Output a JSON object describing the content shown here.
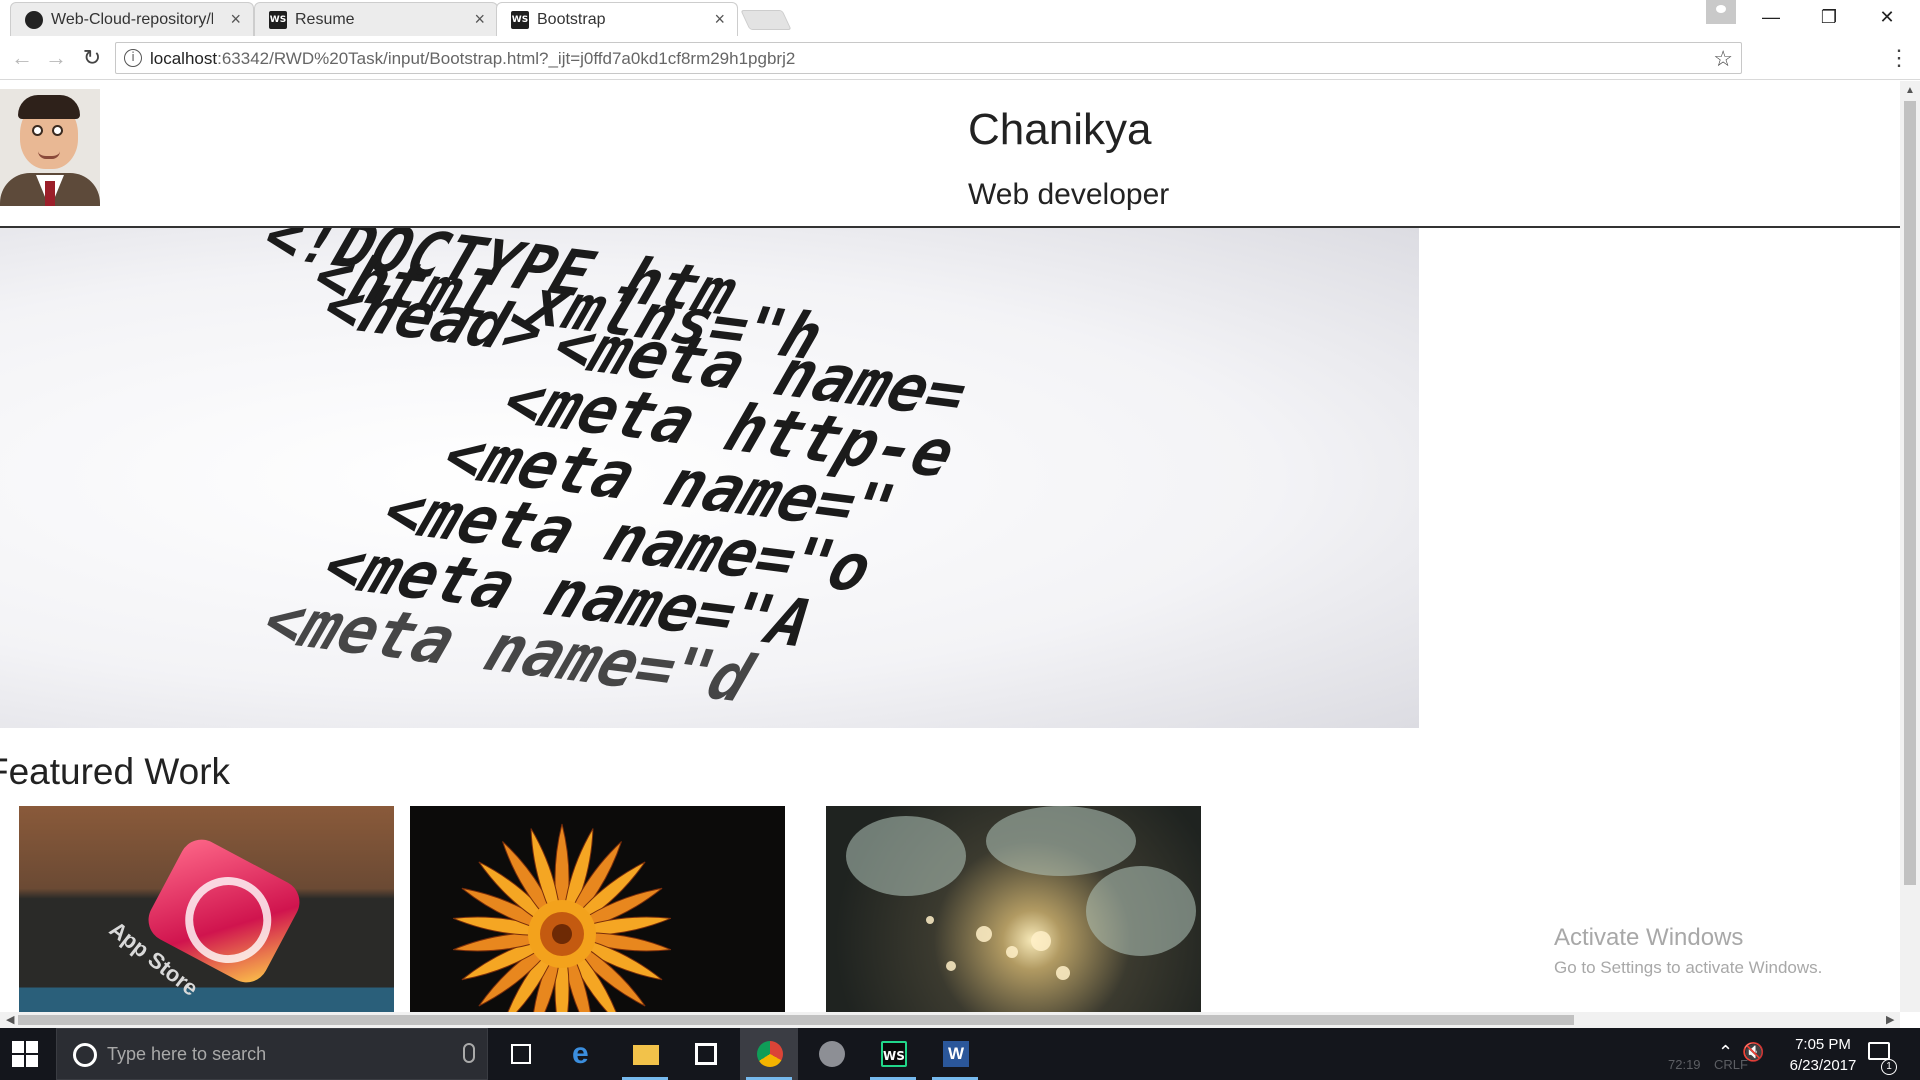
{
  "browser": {
    "tabs": [
      {
        "title": "Web-Cloud-repository/lab",
        "icon": "github-icon",
        "close": "×",
        "active": false
      },
      {
        "title": "Resume",
        "icon": "webstorm-icon",
        "close": "×",
        "active": false
      },
      {
        "title": "Bootstrap",
        "icon": "webstorm-icon",
        "close": "×",
        "active": true
      }
    ],
    "icon_label_ws": "WS",
    "window_controls": {
      "minimize": "—",
      "restore": "❐",
      "close": "✕"
    },
    "nav": {
      "back": "←",
      "forward": "→",
      "reload": "↻",
      "info": "i",
      "star": "☆",
      "menu": "⋮"
    },
    "url_host": "localhost",
    "url_rest": ":63342/RWD%20Task/input/Bootstrap.html?_ijt=j0ffd7a0kd1cf8rm29h1pgbrj2"
  },
  "page": {
    "name": "Chanikya",
    "role": "Web developer",
    "hero_lines": [
      "<!DOCTYPE htm",
      "<html xmlns=\"h",
      "<head>",
      "<meta name=",
      "<meta http-e",
      "<meta name=\"",
      "<meta name=\"o",
      "<meta name=\"A",
      "<meta name=\"d"
    ],
    "section_title": "Featured Work",
    "thumb_caption": "App Store"
  },
  "watermark": {
    "line1": "Activate Windows",
    "line2": "Go to Settings to activate Windows."
  },
  "taskbar": {
    "search_placeholder": "Type here to search",
    "time": "7:05 PM",
    "date": "6/23/2017",
    "notification_count": "1",
    "ghost_left": "72:19",
    "ghost_right": "CRLF"
  },
  "colors": {
    "taskbar": "#14161c",
    "accent": "#76b9ed"
  }
}
